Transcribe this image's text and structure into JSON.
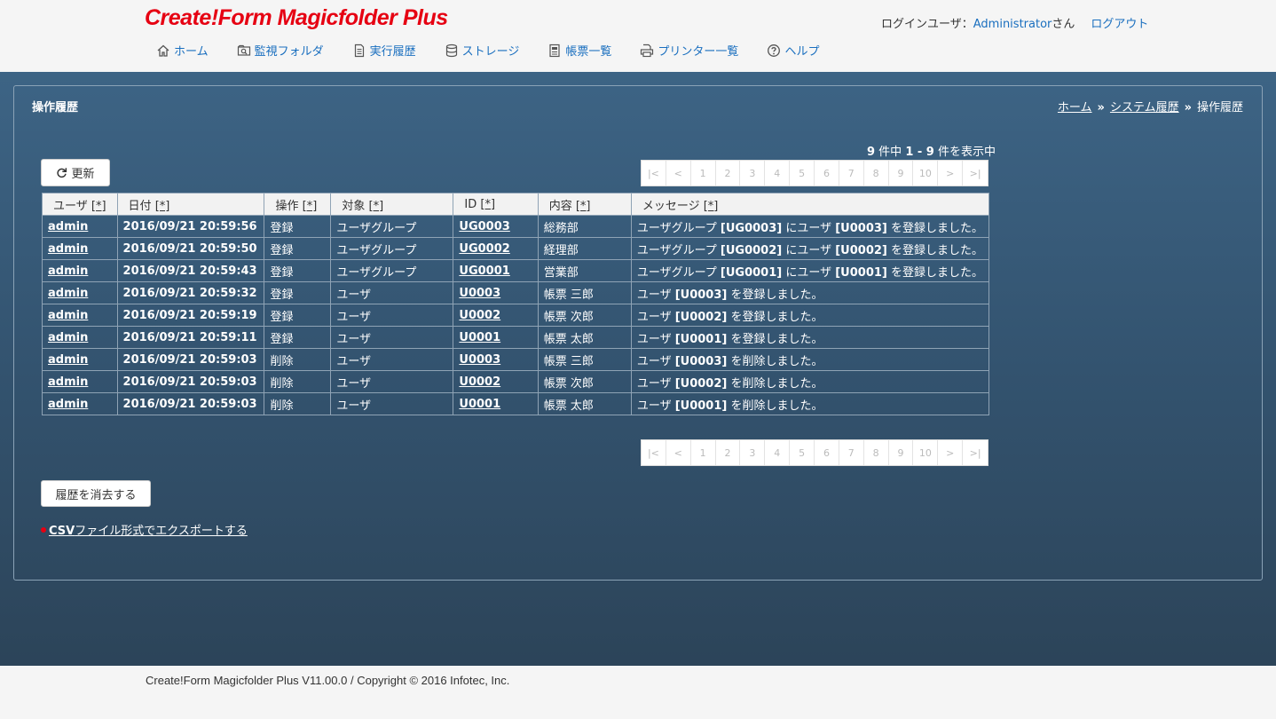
{
  "header": {
    "logo": "Create!Form Magicfolder Plus",
    "login_label": "ログインユーザ：",
    "user_name": "Administrator",
    "user_suffix": "さん",
    "logout": "ログアウト",
    "nav": [
      {
        "label": "ホーム",
        "icon": "home-icon"
      },
      {
        "label": "監視フォルダ",
        "icon": "folder-search-icon"
      },
      {
        "label": "実行履歴",
        "icon": "document-icon"
      },
      {
        "label": "ストレージ",
        "icon": "database-icon"
      },
      {
        "label": "帳票一覧",
        "icon": "form-list-icon"
      },
      {
        "label": "プリンター一覧",
        "icon": "printer-icon"
      },
      {
        "label": "ヘルプ",
        "icon": "help-icon"
      }
    ]
  },
  "page": {
    "title": "操作履歴",
    "breadcrumb": {
      "home": "ホーム",
      "sep": "»",
      "system": "システム履歴",
      "current": "操作履歴"
    },
    "count": {
      "total": "9",
      "total_suffix": " 件中 ",
      "range": "1 - 9",
      "range_suffix": " 件を表示中"
    },
    "refresh_label": "更新",
    "clear_label": "履歴を消去する",
    "export": {
      "csv": "CSV",
      "rest": "ファイル形式でエクスポートする"
    },
    "pager": [
      "|<",
      "<",
      "1",
      "2",
      "3",
      "4",
      "5",
      "6",
      "7",
      "8",
      "9",
      "10",
      ">",
      ">|"
    ]
  },
  "table": {
    "sort_mark": "[*]",
    "columns": [
      "ユーザ",
      "日付",
      "操作",
      "対象",
      "ID",
      "内容",
      "メッセージ"
    ],
    "rows": [
      {
        "user": "admin",
        "date": "2016/09/21 20:59:56",
        "op": "登録",
        "target": "ユーザグループ",
        "id": "UG0003",
        "content": "総務部",
        "msg": {
          "pre": "ユーザグループ ",
          "b1": "[UG0003]",
          "mid": " にユーザ ",
          "b2": "[U0003]",
          "post": " を登録しました。"
        }
      },
      {
        "user": "admin",
        "date": "2016/09/21 20:59:50",
        "op": "登録",
        "target": "ユーザグループ",
        "id": "UG0002",
        "content": "経理部",
        "msg": {
          "pre": "ユーザグループ ",
          "b1": "[UG0002]",
          "mid": " にユーザ ",
          "b2": "[U0002]",
          "post": " を登録しました。"
        }
      },
      {
        "user": "admin",
        "date": "2016/09/21 20:59:43",
        "op": "登録",
        "target": "ユーザグループ",
        "id": "UG0001",
        "content": "営業部",
        "msg": {
          "pre": "ユーザグループ ",
          "b1": "[UG0001]",
          "mid": " にユーザ ",
          "b2": "[U0001]",
          "post": " を登録しました。"
        }
      },
      {
        "user": "admin",
        "date": "2016/09/21 20:59:32",
        "op": "登録",
        "target": "ユーザ",
        "id": "U0003",
        "content": "帳票 三郎",
        "msg": {
          "pre": "ユーザ ",
          "b1": "[U0003]",
          "mid": "",
          "b2": "",
          "post": " を登録しました。"
        }
      },
      {
        "user": "admin",
        "date": "2016/09/21 20:59:19",
        "op": "登録",
        "target": "ユーザ",
        "id": "U0002",
        "content": "帳票 次郎",
        "msg": {
          "pre": "ユーザ ",
          "b1": "[U0002]",
          "mid": "",
          "b2": "",
          "post": " を登録しました。"
        }
      },
      {
        "user": "admin",
        "date": "2016/09/21 20:59:11",
        "op": "登録",
        "target": "ユーザ",
        "id": "U0001",
        "content": "帳票 太郎",
        "msg": {
          "pre": "ユーザ ",
          "b1": "[U0001]",
          "mid": "",
          "b2": "",
          "post": " を登録しました。"
        }
      },
      {
        "user": "admin",
        "date": "2016/09/21 20:59:03",
        "op": "削除",
        "target": "ユーザ",
        "id": "U0003",
        "content": "帳票 三郎",
        "msg": {
          "pre": "ユーザ ",
          "b1": "[U0003]",
          "mid": "",
          "b2": "",
          "post": " を削除しました。"
        }
      },
      {
        "user": "admin",
        "date": "2016/09/21 20:59:03",
        "op": "削除",
        "target": "ユーザ",
        "id": "U0002",
        "content": "帳票 次郎",
        "msg": {
          "pre": "ユーザ ",
          "b1": "[U0002]",
          "mid": "",
          "b2": "",
          "post": " を削除しました。"
        }
      },
      {
        "user": "admin",
        "date": "2016/09/21 20:59:03",
        "op": "削除",
        "target": "ユーザ",
        "id": "U0001",
        "content": "帳票 太郎",
        "msg": {
          "pre": "ユーザ ",
          "b1": "[U0001]",
          "mid": "",
          "b2": "",
          "post": " を削除しました。"
        }
      }
    ]
  },
  "footer": {
    "text": "Create!Form Magicfolder Plus V11.00.0 / Copyright © 2016 Infotec, Inc."
  }
}
